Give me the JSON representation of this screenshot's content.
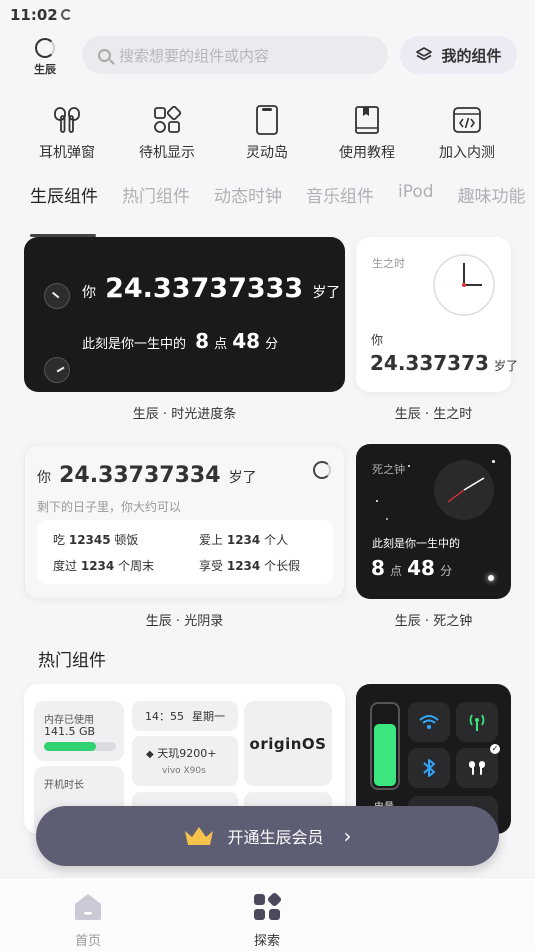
{
  "status_bar": {
    "time": "11:02"
  },
  "header": {
    "logo_text": "生辰",
    "search_placeholder": "搜索想要的组件或内容",
    "my_widgets_label": "我的组件"
  },
  "shortcuts": [
    {
      "label": "耳机弹窗",
      "icon": "earbuds-icon"
    },
    {
      "label": "待机显示",
      "icon": "grid-shapes-icon"
    },
    {
      "label": "灵动岛",
      "icon": "phone-island-icon"
    },
    {
      "label": "使用教程",
      "icon": "book-icon"
    },
    {
      "label": "加入内测",
      "icon": "code-window-icon"
    }
  ],
  "tabs": [
    {
      "label": "生辰组件",
      "active": true
    },
    {
      "label": "热门组件"
    },
    {
      "label": "动态时钟"
    },
    {
      "label": "音乐组件"
    },
    {
      "label": "iPod"
    },
    {
      "label": "趣味功能"
    }
  ],
  "cards": {
    "progress": {
      "line1_prefix": "你",
      "line1_value": "24.33737333",
      "line1_suffix": "岁了",
      "line2_prefix": "此刻是你一生中的",
      "hour": "8",
      "hour_unit": "点",
      "minute": "48",
      "minute_unit": "分",
      "caption": "生辰 · 时光进度条"
    },
    "birth_time": {
      "title": "生之时",
      "prefix": "你",
      "value": "24.337373",
      "suffix": "岁了",
      "caption": "生辰 · 生之时"
    },
    "light_record": {
      "prefix": "你",
      "value": "24.33737334",
      "suffix": "岁了",
      "subtitle": "剩下的日子里，你大约可以",
      "stats": [
        {
          "verb": "吃",
          "num": "12345",
          "unit": "顿饭"
        },
        {
          "verb": "爱上",
          "num": "1234",
          "unit": "个人"
        },
        {
          "verb": "度过",
          "num": "1234",
          "unit": "个周末"
        },
        {
          "verb": "享受",
          "num": "1234",
          "unit": "个长假"
        }
      ],
      "caption": "生辰 · 光阴录"
    },
    "death_clock": {
      "title": "死之钟",
      "line": "此刻是你一生中的",
      "hour": "8",
      "hour_unit": "点",
      "minute": "48",
      "minute_unit": "分",
      "caption": "生辰 · 死之钟"
    }
  },
  "hot": {
    "title": "热门组件",
    "memory_label": "内存已使用",
    "memory_value": "141.5 GB",
    "memory_fraction": 0.72,
    "uptime_label": "开机时长",
    "time": "14：55",
    "weekday": "星期一",
    "chip": "天玑9200+",
    "model": "vivo X90s",
    "brand": "originOS",
    "battery_label": "电量"
  },
  "vip": {
    "label": "开通生辰会员"
  },
  "bottom_nav": [
    {
      "label": "首页"
    },
    {
      "label": "探索",
      "active": true
    }
  ]
}
